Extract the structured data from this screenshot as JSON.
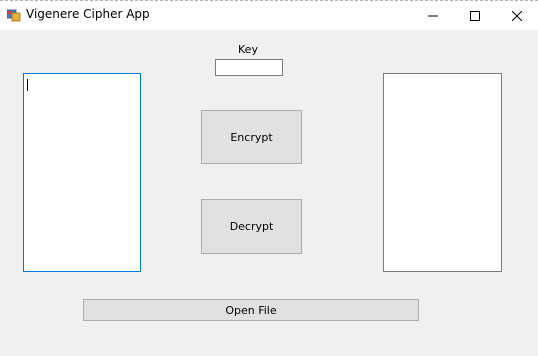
{
  "window": {
    "title": "Vigenere Cipher App",
    "icon": "app-form-icon",
    "controls": {
      "minimize_icon": "minimize-icon",
      "maximize_icon": "maximize-icon",
      "close_icon": "close-icon"
    }
  },
  "form": {
    "key_label": "Key",
    "key_value": "",
    "input_text": "",
    "output_text": "",
    "encrypt_label": "Encrypt",
    "decrypt_label": "Decrypt",
    "open_file_label": "Open File"
  },
  "colors": {
    "focus_border": "#0078d7",
    "button_bg": "#e1e1e1",
    "window_bg": "#f0f0f0"
  }
}
